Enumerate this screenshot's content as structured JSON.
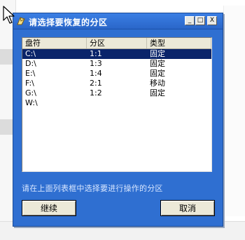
{
  "dialog": {
    "title": "请选择要恢复的分区",
    "window_buttons": {
      "minimize": "_",
      "maximize": "□",
      "close": "X"
    },
    "list": {
      "headers": [
        "盘符",
        "分区",
        "类型"
      ],
      "rows": [
        {
          "drive": "C:\\",
          "partition": "1:1",
          "type": "固定",
          "selected": true
        },
        {
          "drive": "D:\\",
          "partition": "1:3",
          "type": "固定",
          "selected": false
        },
        {
          "drive": "E:\\",
          "partition": "1:4",
          "type": "固定",
          "selected": false
        },
        {
          "drive": "F:\\",
          "partition": "2:1",
          "type": "移动",
          "selected": false
        },
        {
          "drive": "G:\\",
          "partition": "1:2",
          "type": "固定",
          "selected": false
        },
        {
          "drive": "W:\\",
          "partition": "",
          "type": "",
          "selected": false
        }
      ]
    },
    "hint": "请在上面列表框中选择要进行操作的分区",
    "continue_label": "继续",
    "cancel_label": "取消"
  },
  "colors": {
    "dialog_bg": "#2f6fd1",
    "selection": "#0a246a",
    "hint_text": "#d7e6ff"
  },
  "icons": [
    "app-icon",
    "mouse-pointer-icon"
  ]
}
